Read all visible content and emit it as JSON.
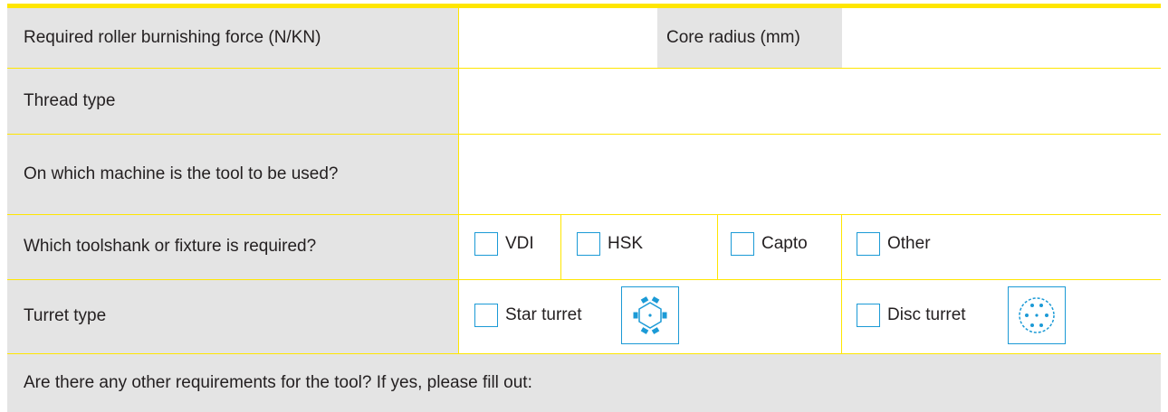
{
  "rows": {
    "force": {
      "label": "Required roller burnishing force (N/KN)",
      "value": ""
    },
    "core_radius": {
      "label": "Core radius (mm)",
      "value": ""
    },
    "thread_type": {
      "label": "Thread type",
      "value": ""
    },
    "machine": {
      "label": "On which machine is the tool to be used?",
      "value": ""
    },
    "toolshank": {
      "label": "Which toolshank or fixture is required?",
      "options": [
        "VDI",
        "HSK",
        "Capto",
        "Other"
      ]
    },
    "turret": {
      "label": "Turret type",
      "options": [
        "Star turret",
        "Disc turret"
      ],
      "icons": [
        "star-turret-icon",
        "disc-turret-icon"
      ]
    },
    "other_requirements": {
      "label": "Are there any other requirements for the tool? If yes, please fill out:"
    }
  },
  "colors": {
    "accent": "#ffe600",
    "checkbox": "#1b9ad6",
    "label_bg": "#e4e4e4"
  }
}
